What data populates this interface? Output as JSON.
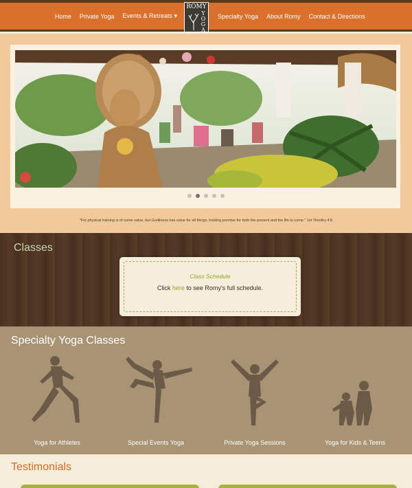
{
  "nav": {
    "left": [
      "Home",
      "Private Yoga",
      "Events & Retreats ▾"
    ],
    "right": [
      "Specialty Yoga",
      "About Romy",
      "Contact & Directions"
    ]
  },
  "logo": {
    "line1": "ROMY",
    "line2": "YOGA"
  },
  "slider": {
    "slides": 5,
    "active_index": 1
  },
  "quote": "\"For physical training is of some value, but Godliness has value for all things, holding promise for both the present and the life to come.\" 1st Timothy 4:8",
  "classes": {
    "heading": "Classes",
    "schedule_title": "Class Schedule",
    "schedule_before": "Click ",
    "schedule_link": "here",
    "schedule_after": " to see Romy's full schedule."
  },
  "specialty": {
    "heading": "Specialty Yoga Classes",
    "items": [
      "Yoga for Athletes",
      "Special Events Yoga",
      "Private Yoga Sessions",
      "Yoga for Kids & Teens"
    ]
  },
  "testimonials": {
    "heading": "Testimonials"
  },
  "colors": {
    "nav": "#d9712c",
    "wood": "#4a3222",
    "accent_green": "#8ea82a",
    "spec_bg": "#a89474",
    "title_orange": "#d16a24"
  }
}
